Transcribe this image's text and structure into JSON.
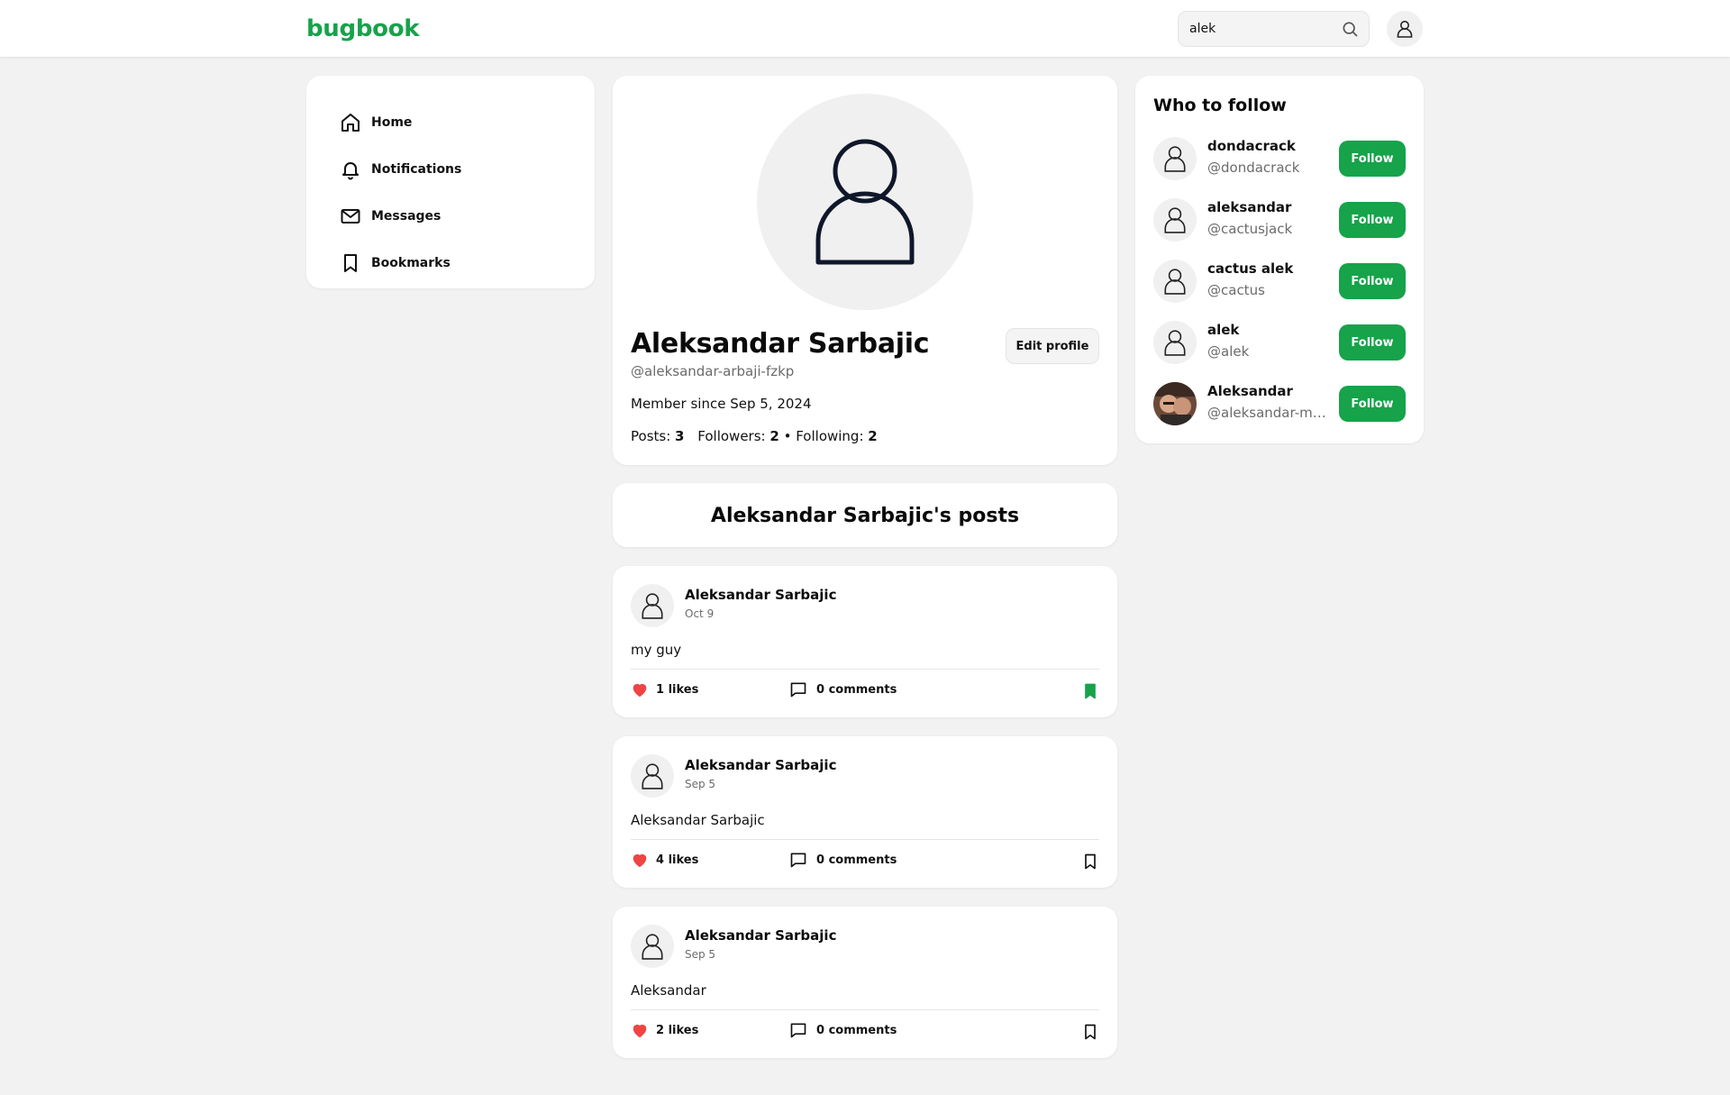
{
  "header": {
    "logo": "bugbook",
    "search_value": "alek",
    "search_icon": "search-icon",
    "avatar_icon": "user-icon"
  },
  "colors": {
    "brand": "#16a34a",
    "like": "#ef4444",
    "background": "#f2f2f2"
  },
  "sidebar": {
    "items": [
      {
        "label": "Home",
        "icon": "home-icon"
      },
      {
        "label": "Notifications",
        "icon": "bell-icon"
      },
      {
        "label": "Messages",
        "icon": "mail-icon"
      },
      {
        "label": "Bookmarks",
        "icon": "bookmark-icon"
      }
    ]
  },
  "profile": {
    "name": "Aleksandar Sarbajic",
    "handle": "@aleksandar-arbaji-fzkp",
    "edit_label": "Edit profile",
    "member_since": "Member since Sep 5, 2024",
    "posts_label": "Posts:",
    "posts_count": "3",
    "followers_label": "Followers:",
    "followers_count": "2",
    "following_label": "• Following:",
    "following_count": "2"
  },
  "posts_heading": "Aleksandar Sarbajic's posts",
  "posts": [
    {
      "author": "Aleksandar Sarbajic",
      "date": "Oct 9",
      "text": "my guy",
      "likes": "1 likes",
      "comments": "0 comments",
      "bookmarked": true
    },
    {
      "author": "Aleksandar Sarbajic",
      "date": "Sep 5",
      "text": "Aleksandar Sarbajic",
      "likes": "4 likes",
      "comments": "0 comments",
      "bookmarked": false
    },
    {
      "author": "Aleksandar Sarbajic",
      "date": "Sep 5",
      "text": "Aleksandar",
      "likes": "2 likes",
      "comments": "0 comments",
      "bookmarked": false
    }
  ],
  "who_to_follow": {
    "title": "Who to follow",
    "users": [
      {
        "name": "dondacrack",
        "handle": "@dondacrack",
        "button": "Follow"
      },
      {
        "name": "aleksandar",
        "handle": "@cactusjack",
        "button": "Follow"
      },
      {
        "name": "cactus alek",
        "handle": "@cactus",
        "button": "Follow"
      },
      {
        "name": "alek",
        "handle": "@alek",
        "button": "Follow"
      },
      {
        "name": "Aleksandar",
        "handle": "@aleksandar-mx...",
        "button": "Follow"
      }
    ]
  }
}
